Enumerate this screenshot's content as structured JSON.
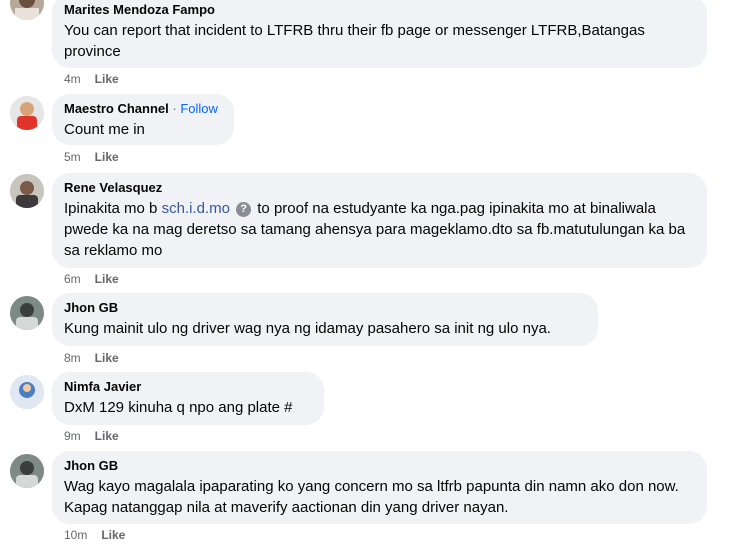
{
  "comments": [
    {
      "author": "Marites Mendoza Fampo",
      "text": "You can report that incident to LTFRB thru their fb page or messenger LTFRB,Batangas province",
      "time": "4m",
      "like": "Like"
    },
    {
      "author": "Maestro Channel",
      "follow_sep": " · ",
      "follow": "Follow",
      "text": "Count me in",
      "time": "5m",
      "like": "Like"
    },
    {
      "author": "Rene Velasquez",
      "text_before": "Ipinakita mo b ",
      "link": "sch.i.d.mo",
      "icon": "?",
      "text_after": " to proof na estudyante ka nga.pag ipinakita mo at binaliwala pwede ka na mag deretso sa tamang ahensya para mageklamo.dto sa fb.matutulungan ka ba sa reklamo mo",
      "time": "6m",
      "like": "Like"
    },
    {
      "author": "Jhon GB",
      "text": "Kung mainit ulo ng driver wag nya ng idamay pasahero sa init ng ulo nya.",
      "time": "8m",
      "like": "Like"
    },
    {
      "author": "Nimfa Javier",
      "text": "DxM 129 kinuha q npo ang plate #",
      "time": "9m",
      "like": "Like"
    },
    {
      "author": "Jhon GB",
      "text": "Wag kayo magalala ipaparating ko yang concern mo sa ltfrb papunta din namn ako don now. Kapag natanggap nila at maverify aactionan din yang driver nayan.",
      "time": "10m",
      "like": "Like"
    }
  ],
  "colors": {
    "bubble": "#f0f2f5",
    "meta": "#65676b",
    "follow": "#0866ff",
    "link": "#385898"
  }
}
